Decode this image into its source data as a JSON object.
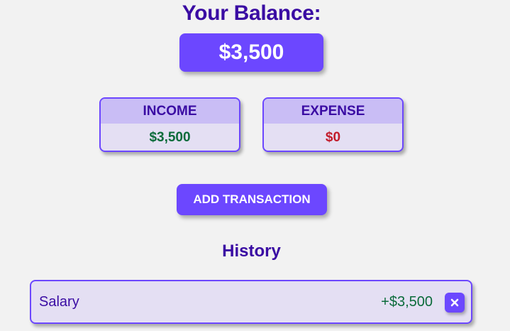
{
  "header": {
    "title": "Your Balance:",
    "balance": "$3,500"
  },
  "summary": {
    "income_label": "INCOME",
    "income_value": "$3,500",
    "expense_label": "EXPENSE",
    "expense_value": "$0"
  },
  "actions": {
    "add_transaction_label": "ADD TRANSACTION"
  },
  "history": {
    "title": "History",
    "items": [
      {
        "name": "Salary",
        "amount": "+$3,500",
        "delete_icon": "close-icon"
      }
    ]
  },
  "colors": {
    "accent": "#6c47ff",
    "heading": "#3a0ca3",
    "income": "#0b6b3a",
    "expense": "#c21c2b",
    "card_bg": "#e4dff3",
    "card_header_bg": "#c9bdf5",
    "page_bg": "#f2f2f2"
  }
}
